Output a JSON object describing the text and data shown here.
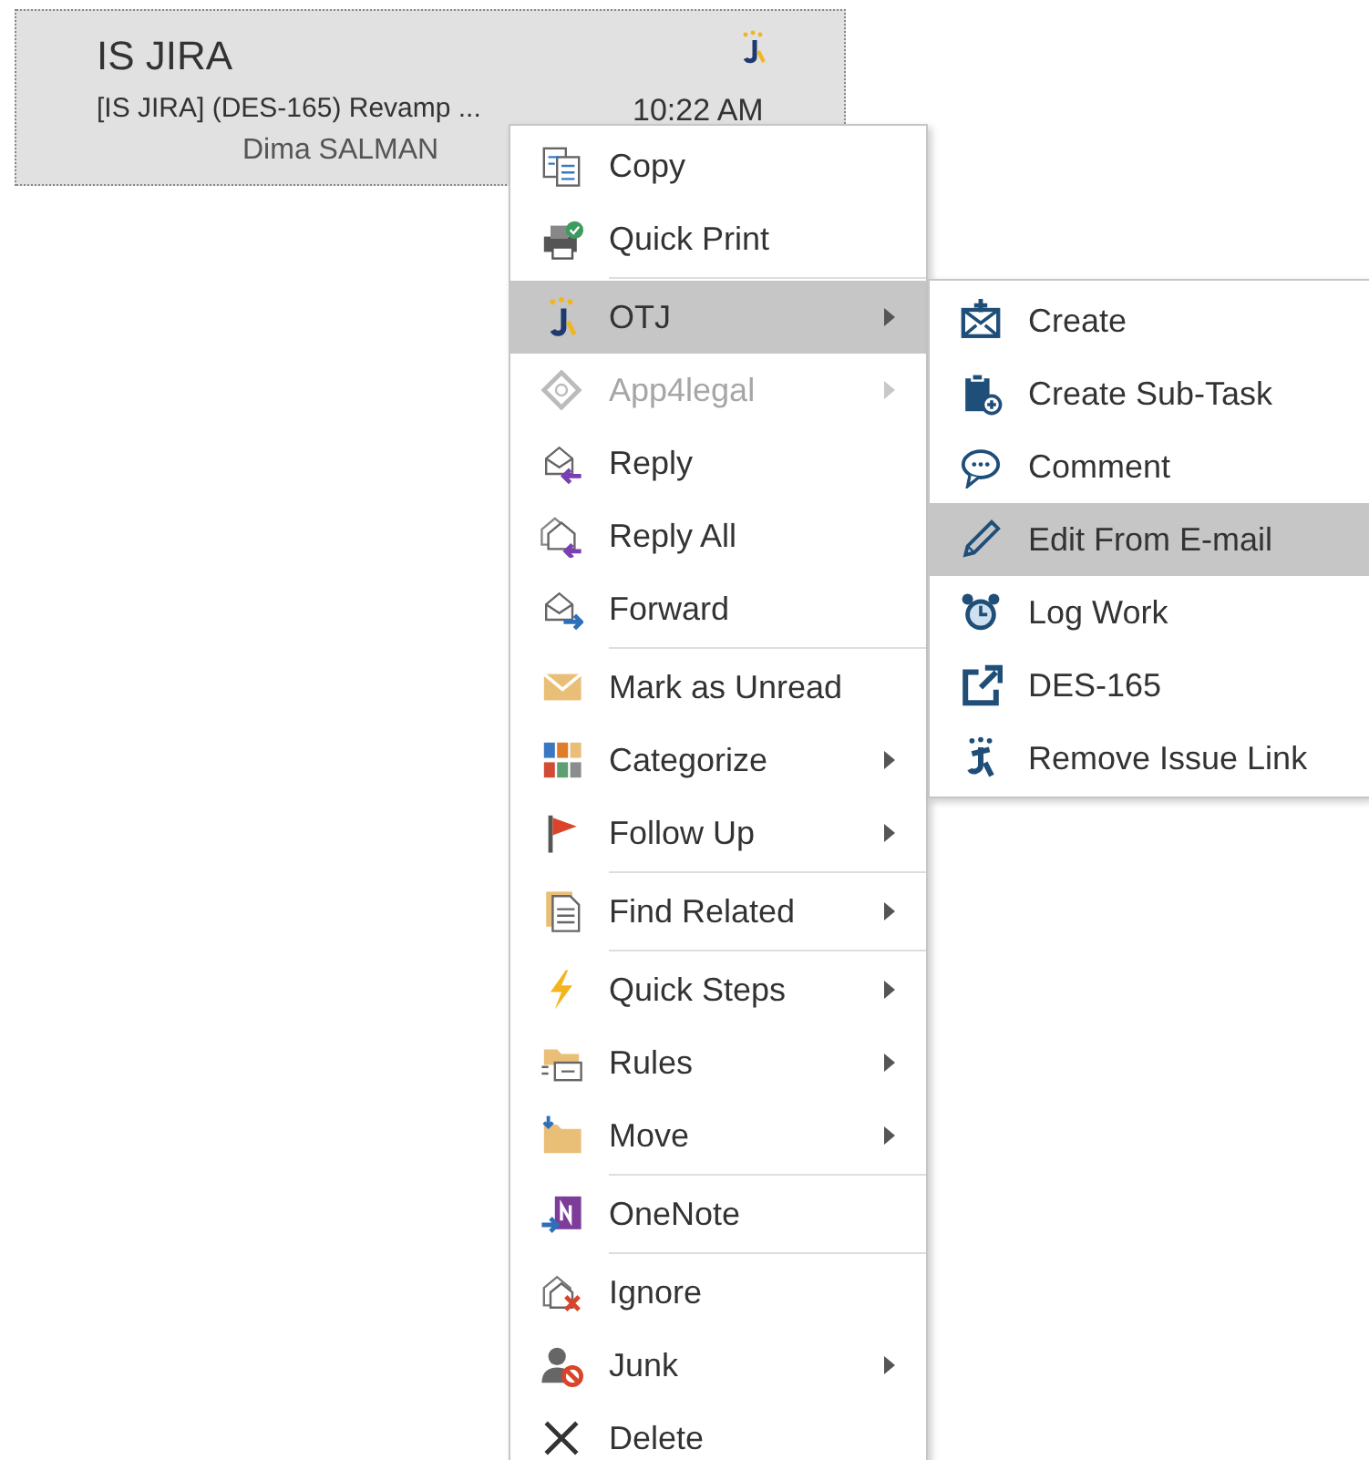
{
  "message": {
    "sender": "IS JIRA",
    "subject": "[IS JIRA] (DES-165) Revamp ...",
    "time": "10:22 AM",
    "from": "Dima SALMAN",
    "selected": true
  },
  "context_menu": {
    "groups": [
      [
        {
          "label": "Copy",
          "selected": false,
          "disabled": false,
          "submenu": false
        },
        {
          "label": "Quick Print",
          "selected": false,
          "disabled": false,
          "submenu": false
        }
      ],
      [
        {
          "label": "OTJ",
          "selected": true,
          "disabled": false,
          "submenu": true
        },
        {
          "label": "App4legal",
          "selected": false,
          "disabled": true,
          "submenu": true
        },
        {
          "label": "Reply",
          "selected": false,
          "disabled": false,
          "submenu": false
        },
        {
          "label": "Reply All",
          "selected": false,
          "disabled": false,
          "submenu": false
        },
        {
          "label": "Forward",
          "selected": false,
          "disabled": false,
          "submenu": false
        }
      ],
      [
        {
          "label": "Mark as Unread",
          "selected": false,
          "disabled": false,
          "submenu": false
        },
        {
          "label": "Categorize",
          "selected": false,
          "disabled": false,
          "submenu": true
        },
        {
          "label": "Follow Up",
          "selected": false,
          "disabled": false,
          "submenu": true
        }
      ],
      [
        {
          "label": "Find Related",
          "selected": false,
          "disabled": false,
          "submenu": true
        }
      ],
      [
        {
          "label": "Quick Steps",
          "selected": false,
          "disabled": false,
          "submenu": true
        },
        {
          "label": "Rules",
          "selected": false,
          "disabled": false,
          "submenu": true
        },
        {
          "label": "Move",
          "selected": false,
          "disabled": false,
          "submenu": true
        }
      ],
      [
        {
          "label": "OneNote",
          "selected": false,
          "disabled": false,
          "submenu": false
        }
      ],
      [
        {
          "label": "Ignore",
          "selected": false,
          "disabled": false,
          "submenu": false
        },
        {
          "label": "Junk",
          "selected": false,
          "disabled": false,
          "submenu": true
        },
        {
          "label": "Delete",
          "selected": false,
          "disabled": false,
          "submenu": false
        }
      ]
    ]
  },
  "submenu": {
    "items": [
      {
        "label": "Create",
        "selected": false
      },
      {
        "label": "Create Sub-Task",
        "selected": false
      },
      {
        "label": "Comment",
        "selected": false
      },
      {
        "label": "Edit From E-mail",
        "selected": true
      },
      {
        "label": "Log Work",
        "selected": false
      },
      {
        "label": "DES-165",
        "selected": false
      },
      {
        "label": "Remove Issue Link",
        "selected": false
      }
    ]
  }
}
